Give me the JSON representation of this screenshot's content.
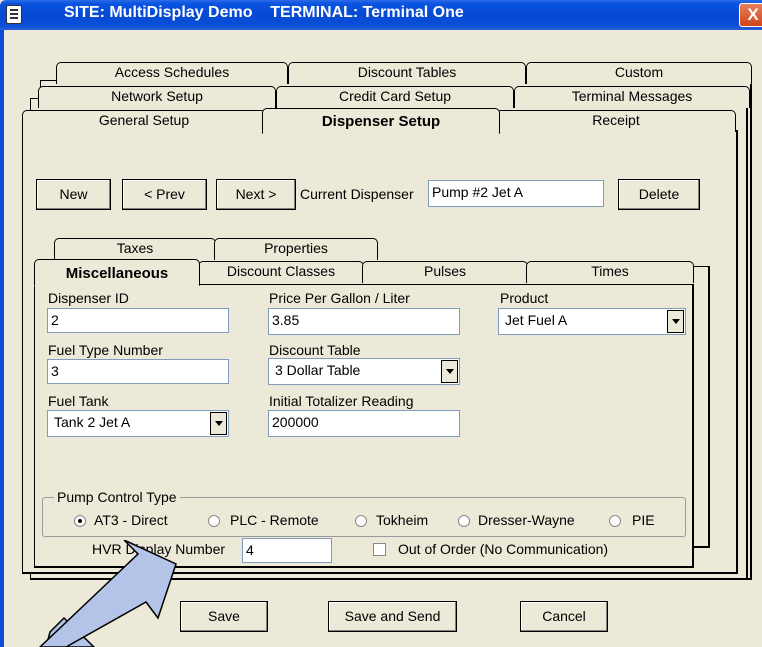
{
  "window": {
    "title": "SITE: MultiDisplay Demo    TERMINAL: Terminal One",
    "close_label": "X"
  },
  "outer_tabs": {
    "row1": [
      "Access Schedules",
      "Discount Tables",
      "Custom"
    ],
    "row2": [
      "Network Setup",
      "Credit Card Setup",
      "Terminal Messages"
    ],
    "row3": [
      "General Setup",
      "Dispenser Setup",
      "Receipt"
    ],
    "selected": "Dispenser Setup"
  },
  "toolbar": {
    "new_label": "New",
    "prev_label": "< Prev",
    "next_label": "Next >",
    "current_dispenser_label": "Current Dispenser",
    "current_dispenser_value": "Pump #2 Jet A",
    "delete_label": "Delete"
  },
  "inner_tabs": {
    "row1": [
      "Taxes",
      "Properties"
    ],
    "row2": [
      "Miscellaneous",
      "Discount Classes",
      "Pulses",
      "Times"
    ],
    "selected": "Miscellaneous"
  },
  "form": {
    "dispenser_id_label": "Dispenser ID",
    "dispenser_id": "2",
    "price_label": "Price Per Gallon / Liter",
    "price": "3.85",
    "product_label": "Product",
    "product": "Jet Fuel A",
    "fuel_type_label": "Fuel Type Number",
    "fuel_type": "3",
    "discount_table_label": "Discount Table",
    "discount_table": "3 Dollar Table",
    "fuel_tank_label": "Fuel Tank",
    "fuel_tank": "Tank 2 Jet A",
    "totalizer_label": "Initial Totalizer Reading",
    "totalizer": "200000"
  },
  "pump_control": {
    "group_label": "Pump Control Type",
    "options": [
      "AT3 - Direct",
      "PLC - Remote",
      "Tokheim",
      "Dresser-Wayne",
      "PIE"
    ],
    "selected_index": 0
  },
  "hvr": {
    "label": "HVR Display Number",
    "value": "4"
  },
  "out_of_order": {
    "label": "Out of Order (No Communication)",
    "checked": false
  },
  "footer": {
    "save_label": "Save",
    "save_send_label": "Save and Send",
    "cancel_label": "Cancel"
  },
  "colors": {
    "titlebar": "#0A4ED8",
    "dialog_bg": "#ECE9D8",
    "arrow_fill": "#B4C3E8",
    "close_button": "#D1441B"
  }
}
